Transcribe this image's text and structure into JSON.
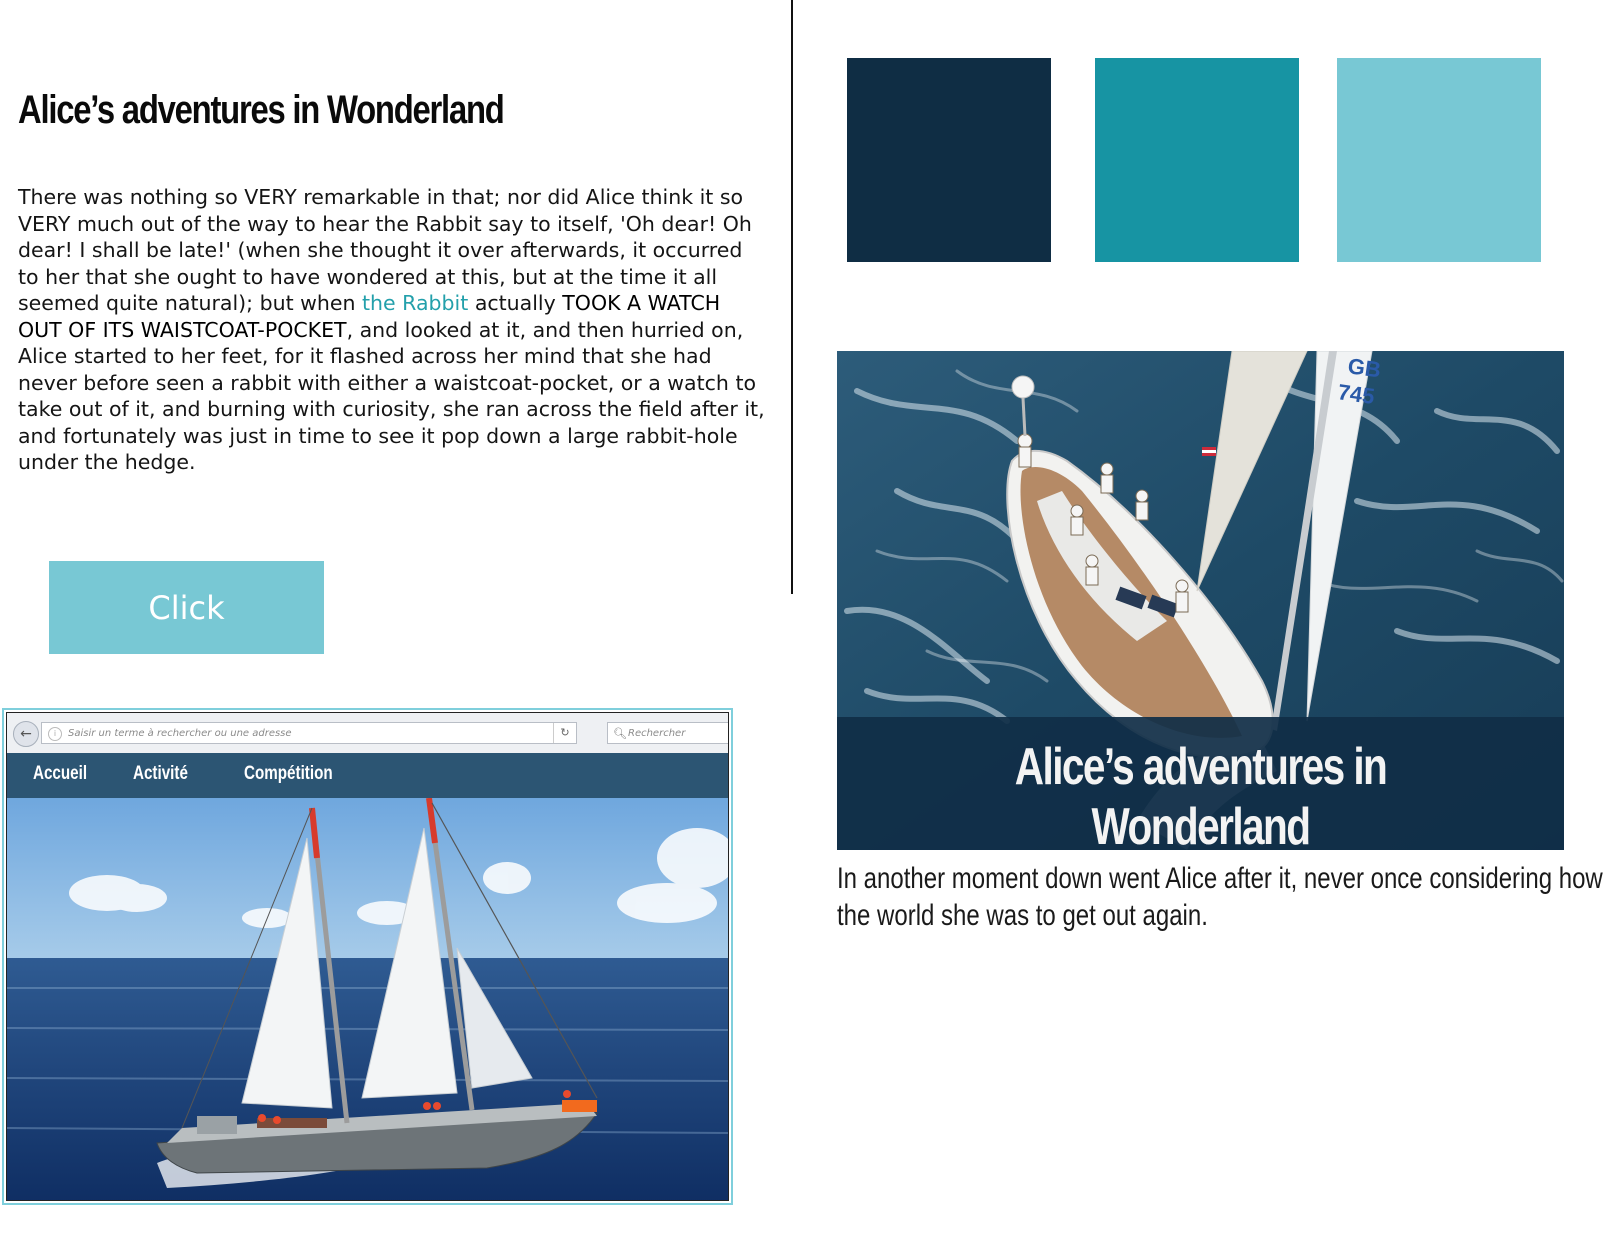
{
  "left": {
    "title": "Alice’s adventures in Wonderland",
    "paragraph": {
      "part1": "There was nothing so VERY remarkable in that; nor did Alice think it so VERY much out of the way to hear the Rabbit say to itself, 'Oh dear! Oh dear! I shall be late!' (when she thought it over afterwards, it occurred to her that she ought to have wondered at this, but at the time it all seemed quite natural); but when ",
      "link": "the Rabbit",
      "part2": " actually ",
      "caps": "TOOK A WATCH OUT OF ITS WAISTCOAT-POCKET",
      "part3": ", and looked at it, and then hurried on,",
      "part4": "Alice started to her feet, for it flashed across her mind that she had never before seen a rabbit with either a waistcoat-pocket, or a watch to take out of it, and burning with curiosity, she ran across the field after it, and fortunately was just in time to see it pop down a large rabbit-hole under the hedge."
    },
    "button_label": "Click"
  },
  "palette": {
    "colors": [
      "#0f2d44",
      "#1794a3",
      "#78c8d4"
    ]
  },
  "hero": {
    "title": "Alice’s adventures in Wonderland",
    "caption_line1": "In another moment down went Alice after it, never once considering how in",
    "caption_line2": "the world she was to get out again."
  },
  "browser": {
    "url_placeholder": "Saisir un terme à rechercher ou une adresse",
    "search_placeholder": "Rechercher",
    "nav": [
      "Accueil",
      "Activité",
      "Compétition"
    ]
  },
  "accent_colors": {
    "link": "#23a0ab",
    "button": "#78c8d4",
    "navbar": "#2c5573",
    "hero_band": "#102e46"
  }
}
